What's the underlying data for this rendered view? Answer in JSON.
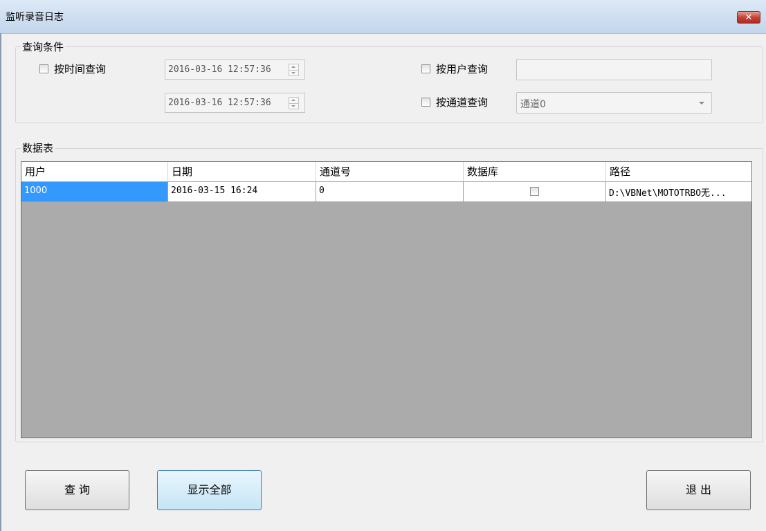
{
  "window": {
    "title": "监听录音日志",
    "close_label": "✕"
  },
  "query": {
    "group_label": "查询条件",
    "by_time": {
      "label": "按时间查询",
      "checked": false
    },
    "start_time": "2016-03-16 12:57:36",
    "end_time": "2016-03-16 12:57:36",
    "by_user": {
      "label": "按用户查询",
      "checked": false,
      "value": ""
    },
    "by_channel": {
      "label": "按通道查询",
      "checked": false,
      "selected": "通道0"
    }
  },
  "table": {
    "group_label": "数据表",
    "columns": [
      "用户",
      "日期",
      "通道号",
      "数据库",
      "路径"
    ],
    "rows": [
      {
        "user": "1000",
        "date": "2016-03-15 16:24",
        "channel": "0",
        "database": false,
        "path": "D:\\VBNet\\MOTOTRBO无..."
      }
    ]
  },
  "buttons": {
    "query": "查 询",
    "show_all": "显示全部",
    "exit": "退 出"
  },
  "colors": {
    "selection": "#3399ff",
    "grid_empty": "#ababab",
    "title_gradient": "#c2d6ec"
  }
}
